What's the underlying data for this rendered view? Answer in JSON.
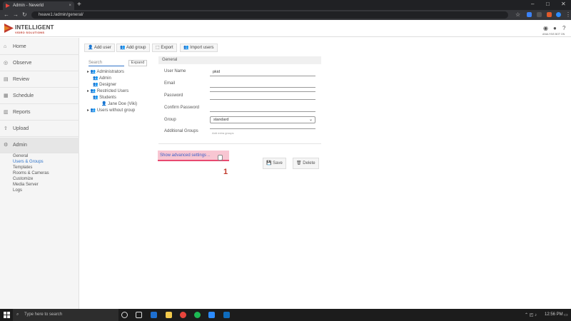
{
  "browser": {
    "tab_title": "Admin - Neverld",
    "tab_close": "×",
    "new_tab": "+",
    "url": "heave1:/admin/general/",
    "win_min": "–",
    "win_max": "□",
    "win_close": "✕"
  },
  "header": {
    "logo_title": "INTELLIGENT",
    "logo_subtitle": "VIDEO SOLUTIONS",
    "user_caption": "ANALYSIS BOT ON"
  },
  "sidebar": {
    "items": [
      {
        "label": "Home",
        "icon": "home-icon"
      },
      {
        "label": "Observe",
        "icon": "eye-icon"
      },
      {
        "label": "Review",
        "icon": "review-icon"
      },
      {
        "label": "Schedule",
        "icon": "calendar-icon"
      },
      {
        "label": "Reports",
        "icon": "chart-icon"
      },
      {
        "label": "Upload",
        "icon": "upload-icon"
      },
      {
        "label": "Admin",
        "icon": "gear-icon"
      }
    ],
    "sub_items": [
      "General",
      "Users & Groups",
      "Templates",
      "Rooms & Cameras",
      "Customize",
      "Media Server",
      "Logs"
    ]
  },
  "toolbar": {
    "add_user": "Add user",
    "add_group": "Add group",
    "export": "Export",
    "import_users": "Import users"
  },
  "tree": {
    "search_placeholder": "Search",
    "expand_label": "Expand",
    "nodes": [
      "Administrators",
      "Admin",
      "Designer",
      "Restricted Users",
      "Students",
      "Jane Doe (Viki)",
      "Users without group"
    ]
  },
  "form": {
    "section_title": "General",
    "user_name_label": "User Name",
    "user_name_value": "pkid",
    "email_label": "Email",
    "password_label": "Password",
    "confirm_label": "Confirm Password",
    "group_label": "Group",
    "group_value": "standard",
    "additional_groups_label": "Additional Groups",
    "additional_groups_placeholder": "Add extra groups",
    "advanced_link": "Show advanced settings ..",
    "save": "Save",
    "delete": "Delete"
  },
  "annotation": {
    "step": "1"
  },
  "taskbar": {
    "search_placeholder": "Type here to search",
    "time": "12:56 PM"
  },
  "colors": {
    "accent": "#2f73c9",
    "highlight": "#f8c6d2",
    "highlight_border": "#e84a70",
    "step_marker": "#c0392b"
  }
}
